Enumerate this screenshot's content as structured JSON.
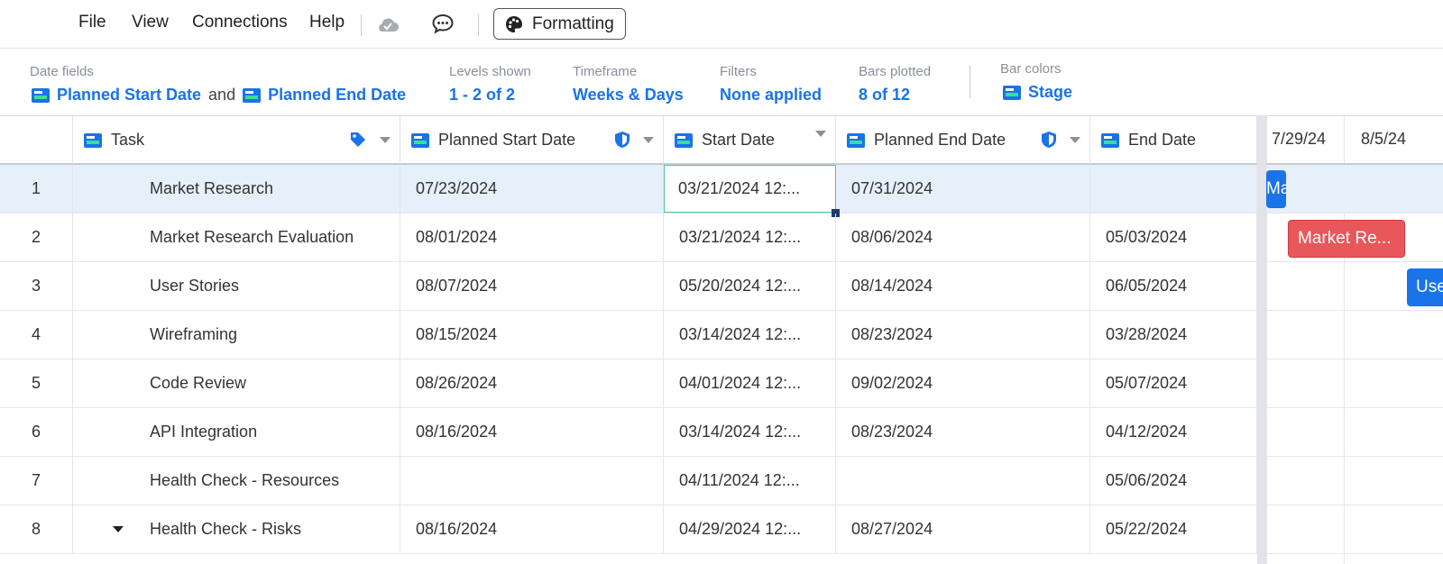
{
  "menu": {
    "file": "File",
    "view": "View",
    "connections": "Connections",
    "help": "Help",
    "formatting": "Formatting"
  },
  "settings": {
    "date_fields_label": "Date fields",
    "date_start": "Planned Start Date",
    "date_and": "and",
    "date_end": "Planned End Date",
    "levels_label": "Levels shown",
    "levels_value": "1 - 2 of 2",
    "timeframe_label": "Timeframe",
    "timeframe_value": "Weeks & Days",
    "filters_label": "Filters",
    "filters_value": "None applied",
    "bars_label": "Bars plotted",
    "bars_value": "8 of 12",
    "colors_label": "Bar colors",
    "colors_value": "Stage"
  },
  "columns": {
    "task": "Task",
    "planned_start": "Planned Start Date",
    "start": "Start Date",
    "planned_end": "Planned End Date",
    "end": "End Date"
  },
  "rows": [
    {
      "num": "1",
      "task": "Market Research",
      "planned_start": "07/23/2024",
      "start": "03/21/2024 12:...",
      "planned_end": "07/31/2024",
      "end": ""
    },
    {
      "num": "2",
      "task": "Market Research Evaluation",
      "planned_start": "08/01/2024",
      "start": "03/21/2024 12:...",
      "planned_end": "08/06/2024",
      "end": "05/03/2024"
    },
    {
      "num": "3",
      "task": "User Stories",
      "planned_start": "08/07/2024",
      "start": "05/20/2024 12:...",
      "planned_end": "08/14/2024",
      "end": "06/05/2024"
    },
    {
      "num": "4",
      "task": "Wireframing",
      "planned_start": "08/15/2024",
      "start": "03/14/2024 12:...",
      "planned_end": "08/23/2024",
      "end": "03/28/2024"
    },
    {
      "num": "5",
      "task": "Code Review",
      "planned_start": "08/26/2024",
      "start": "04/01/2024 12:...",
      "planned_end": "09/02/2024",
      "end": "05/07/2024"
    },
    {
      "num": "6",
      "task": "API Integration",
      "planned_start": "08/16/2024",
      "start": "03/14/2024 12:...",
      "planned_end": "08/23/2024",
      "end": "04/12/2024"
    },
    {
      "num": "7",
      "task": "Health Check - Resources",
      "planned_start": "",
      "start": "04/11/2024 12:...",
      "planned_end": "",
      "end": "05/06/2024"
    },
    {
      "num": "8",
      "task": "Health Check - Risks",
      "planned_start": "08/16/2024",
      "start": "04/29/2024 12:...",
      "planned_end": "08/27/2024",
      "end": "05/22/2024"
    }
  ],
  "timeline": {
    "dates": [
      "7/29/24",
      "8/5/24"
    ],
    "bars": [
      {
        "label": "Ma",
        "color": "#1a73e8"
      },
      {
        "label": "Market Re...",
        "color": "#e8575a"
      },
      {
        "label": "Use",
        "color": "#1a73e8"
      }
    ]
  },
  "colors": {
    "accent": "#1a73e8",
    "selected_row": "#e6f0fb",
    "bar_red": "#e8575a"
  }
}
